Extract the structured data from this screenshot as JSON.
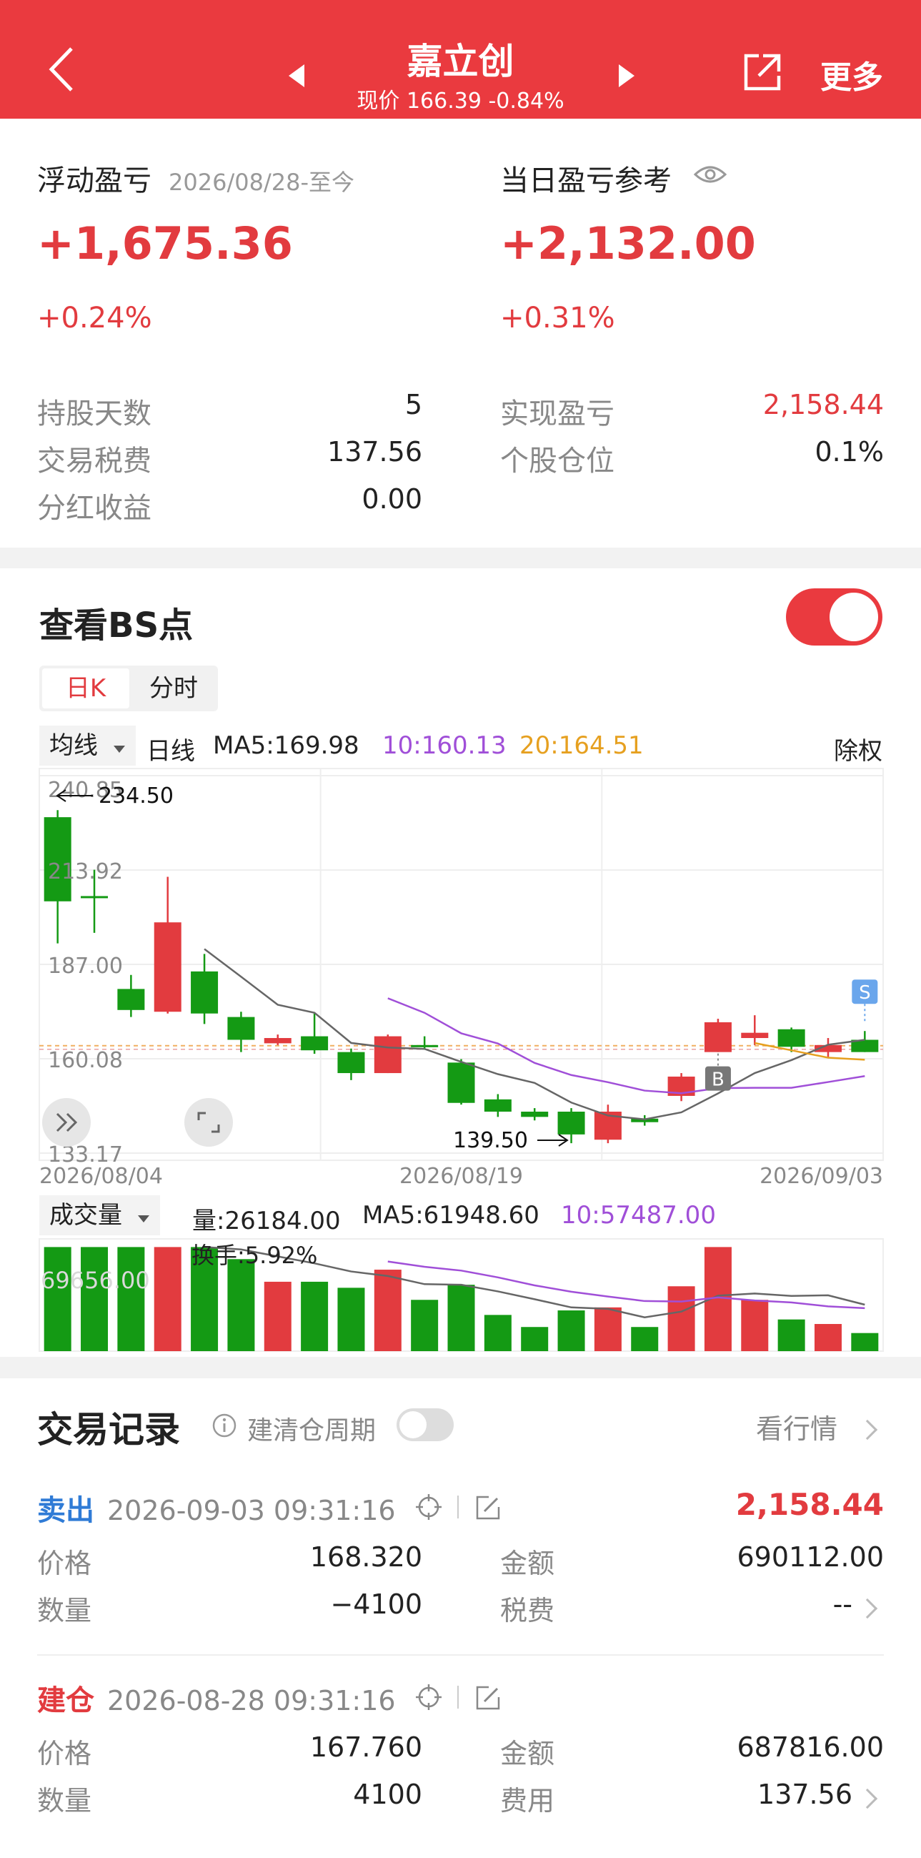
{
  "header": {
    "title": "嘉立创",
    "subtitle": "现价 166.39 -0.84%",
    "more": "更多"
  },
  "summary": {
    "floating_label": "浮动盈亏",
    "floating_date": "2026/08/28-至今",
    "floating_value": "+1,675.36",
    "floating_pct": "+0.24%",
    "daily_label": "当日盈亏参考",
    "daily_value": "+2,132.00",
    "daily_pct": "+0.31%",
    "left_kv": [
      {
        "k": "持股天数",
        "v": "5"
      },
      {
        "k": "交易税费",
        "v": "137.56"
      },
      {
        "k": "分红收益",
        "v": "0.00"
      }
    ],
    "right_kv": [
      {
        "k": "实现盈亏",
        "v": "2,158.44"
      },
      {
        "k": "个股仓位",
        "v": "0.1%"
      }
    ]
  },
  "bs": {
    "title": "查看BS点",
    "tab_daily": "日K",
    "tab_minute": "分时",
    "ma_dropdown": "均线",
    "ma_line": "日线",
    "ma5": "MA5:169.98",
    "ma10": "10:160.13",
    "ma20": "20:164.51",
    "adjust": "除权",
    "vol_dropdown": "成交量",
    "vol_value": "量:26184.00",
    "vol_ma5": "MA5:61948.60",
    "vol_ma10": "10:57487.00",
    "turnover": "换手:5.92%"
  },
  "chart_data": {
    "type": "candlestick",
    "y_tick_labels": [
      "240.85",
      "213.92",
      "187.00",
      "160.08",
      "133.17"
    ],
    "ylim": [
      133.17,
      240.85
    ],
    "x_tick_labels": [
      "2026/08/04",
      "2026/08/19",
      "2026/09/03"
    ],
    "max_label": "234.50",
    "min_label": "139.50",
    "buy_marker": "B",
    "sell_marker": "S",
    "volume_axis_label": "69656.00",
    "colors": {
      "up": "#e23b3f",
      "down": "#149a14",
      "ma5": "#666666",
      "ma10": "#a04fd8",
      "ma20": "#e6a020"
    },
    "candles": [
      {
        "o": 229.0,
        "h": 231.0,
        "l": 193.0,
        "c": 205.0
      },
      {
        "o": 206.5,
        "h": 214.0,
        "l": 196.0,
        "c": 206.0
      },
      {
        "o": 180.0,
        "h": 184.0,
        "l": 172.0,
        "c": 174.0
      },
      {
        "o": 173.5,
        "h": 212.0,
        "l": 173.0,
        "c": 199.0
      },
      {
        "o": 185.0,
        "h": 190.0,
        "l": 170.0,
        "c": 173.0
      },
      {
        "o": 172.0,
        "h": 173.5,
        "l": 162.0,
        "c": 165.5
      },
      {
        "o": 164.5,
        "h": 167.0,
        "l": 164.0,
        "c": 166.0
      },
      {
        "o": 166.5,
        "h": 173.0,
        "l": 161.5,
        "c": 162.5
      },
      {
        "o": 162.0,
        "h": 163.0,
        "l": 154.0,
        "c": 156.0
      },
      {
        "o": 156.0,
        "h": 167.0,
        "l": 156.0,
        "c": 166.5
      },
      {
        "o": 164.0,
        "h": 166.5,
        "l": 163.0,
        "c": 163.5
      },
      {
        "o": 159.0,
        "h": 160.0,
        "l": 147.0,
        "c": 147.5
      },
      {
        "o": 148.5,
        "h": 150.0,
        "l": 143.5,
        "c": 145.0
      },
      {
        "o": 145.0,
        "h": 146.0,
        "l": 142.5,
        "c": 143.5
      },
      {
        "o": 145.0,
        "h": 146.0,
        "l": 136.0,
        "c": 138.5
      },
      {
        "o": 137.0,
        "h": 147.0,
        "l": 136.0,
        "c": 145.0
      },
      {
        "o": 143.0,
        "h": 144.0,
        "l": 141.0,
        "c": 142.0
      },
      {
        "o": 149.5,
        "h": 156.0,
        "l": 148.0,
        "c": 155.0
      },
      {
        "o": 162.0,
        "h": 171.5,
        "l": 162.0,
        "c": 170.5
      },
      {
        "o": 166.0,
        "h": 172.5,
        "l": 164.0,
        "c": 167.5
      },
      {
        "o": 168.5,
        "h": 169.0,
        "l": 162.0,
        "c": 163.5
      },
      {
        "o": 162.0,
        "h": 166.0,
        "l": 160.5,
        "c": 164.0
      },
      {
        "o": 165.5,
        "h": 168.0,
        "l": 162.0,
        "c": 162.0
      }
    ],
    "volumes": [
      69000,
      69000,
      69000,
      69000,
      69000,
      61000,
      46000,
      46000,
      42000,
      54000,
      34000,
      44000,
      24000,
      16000,
      27000,
      29000,
      16000,
      43000,
      69000,
      34000,
      21000,
      18000,
      12000
    ],
    "buy_index": 18,
    "sell_index": 22
  },
  "records": {
    "title": "交易记录",
    "option": "建清仓周期",
    "market": "看行情",
    "entries": [
      {
        "type": "卖出",
        "time": "2026-09-03 09:31:16",
        "amount": "2,158.44",
        "k1": "价格",
        "v1": "168.320",
        "k2": "金额",
        "v2": "690112.00",
        "k3": "数量",
        "v3": "−4100",
        "k4": "税费",
        "v4": "--"
      },
      {
        "type": "建仓",
        "time": "2026-08-28 09:31:16",
        "amount": "",
        "k1": "价格",
        "v1": "167.760",
        "k2": "金额",
        "v2": "687816.00",
        "k3": "数量",
        "v3": "4100",
        "k4": "费用",
        "v4": "137.56"
      }
    ]
  }
}
